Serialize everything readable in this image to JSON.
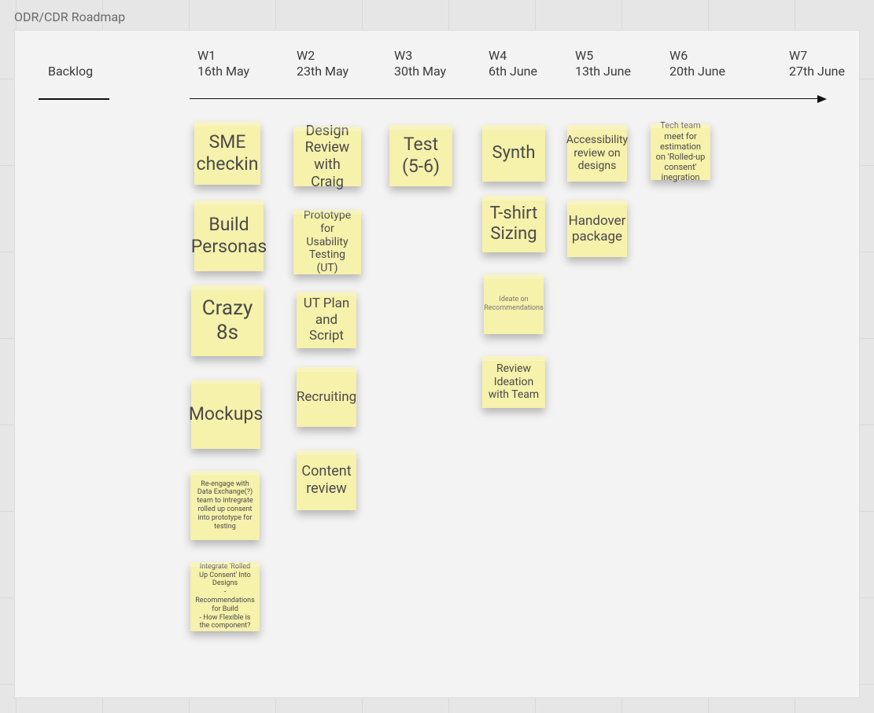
{
  "frame_title": "ODR/CDR Roadmap",
  "columns": {
    "backlog": {
      "label": "Backlog"
    },
    "w1": {
      "week": "W1",
      "date": "16th May"
    },
    "w2": {
      "week": "W2",
      "date": "23th May"
    },
    "w3": {
      "week": "W3",
      "date": "30th May"
    },
    "w4": {
      "week": "W4",
      "date": "6th June"
    },
    "w5": {
      "week": "W5",
      "date": "13th June"
    },
    "w6": {
      "week": "W6",
      "date": "20th June"
    },
    "w7": {
      "week": "W7",
      "date": "27th June"
    }
  },
  "stickies": {
    "w1": [
      "SME checkin",
      "Build Personas",
      "Crazy 8s",
      "Mockups",
      "Re-engage with Data Exchange(?) team to intregrate rolled up consent into prototype for testing",
      "Integrate 'Rolled Up Consent' Into Designs\n- Recommendations for Build\n- How Flexible is the component?"
    ],
    "w2": [
      "Design Review with Craig",
      "Prototype for Usability Testing (UT)",
      "UT Plan and Script",
      "Recruiting",
      "Content review"
    ],
    "w3": [
      "Test (5-6)"
    ],
    "w4": [
      "Synth",
      "T-shirt Sizing",
      "Ideate on Recommendations",
      "Review Ideation with Team"
    ],
    "w5": [
      "Accessibility review on designs",
      "Handover package"
    ],
    "w6": [
      "Tech team meet for estimation on 'Rolled-up consent' inegration"
    ]
  }
}
